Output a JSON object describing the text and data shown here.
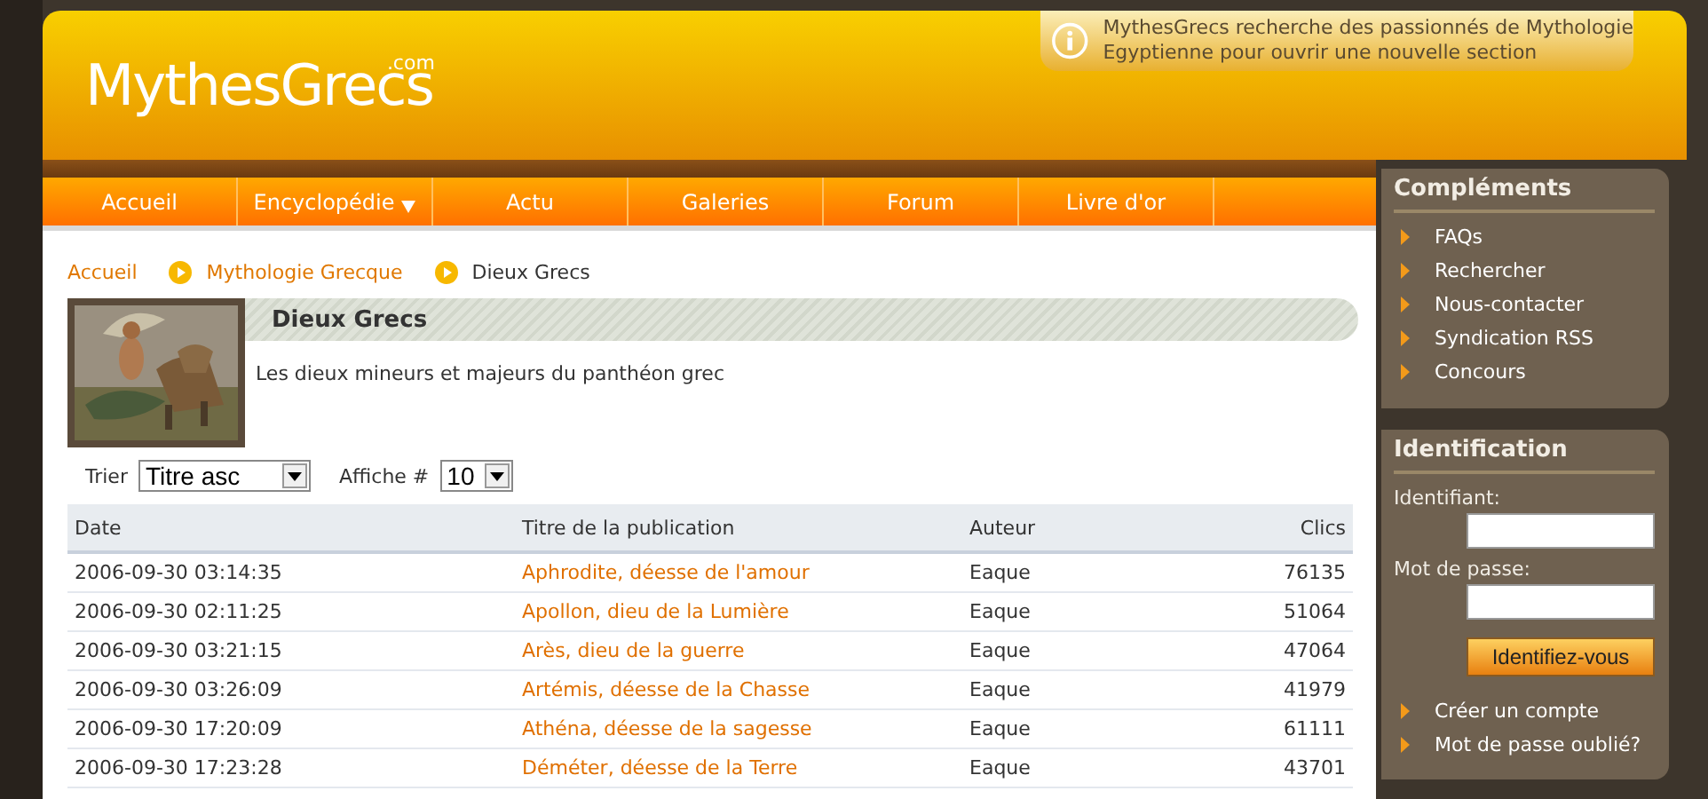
{
  "logo": {
    "name": "MythesGrecs",
    "suffix": ".com"
  },
  "notice": {
    "lines": [
      "MythesGrecs recherche des passionnés de Mythologie",
      "Egyptienne pour ouvrir une nouvelle section"
    ]
  },
  "nav": [
    {
      "label": "Accueil",
      "dropdown": false
    },
    {
      "label": "Encyclopédie",
      "dropdown": true
    },
    {
      "label": "Actu",
      "dropdown": false
    },
    {
      "label": "Galeries",
      "dropdown": false
    },
    {
      "label": "Forum",
      "dropdown": false
    },
    {
      "label": "Livre d'or",
      "dropdown": false
    }
  ],
  "breadcrumb": [
    {
      "label": "Accueil",
      "link": true
    },
    {
      "label": "Mythologie Grecque",
      "link": true
    },
    {
      "label": "Dieux Grecs",
      "link": false
    }
  ],
  "page": {
    "title": "Dieux Grecs",
    "description": "Les dieux mineurs et majeurs du panthéon grec"
  },
  "sort": {
    "label": "Trier",
    "value": "Titre asc"
  },
  "per_page": {
    "label": "Affiche #",
    "value": "10"
  },
  "table": {
    "columns": [
      "Date",
      "Titre de la publication",
      "Auteur",
      "Clics"
    ],
    "rows": [
      [
        "2006-09-30 03:14:35",
        "Aphrodite, déesse de l'amour",
        "Eaque",
        "76135"
      ],
      [
        "2006-09-30 02:11:25",
        "Apollon, dieu de la Lumière",
        "Eaque",
        "51064"
      ],
      [
        "2006-09-30 03:21:15",
        "Arès, dieu de la guerre",
        "Eaque",
        "47064"
      ],
      [
        "2006-09-30 03:26:09",
        "Artémis, déesse de la Chasse",
        "Eaque",
        "41979"
      ],
      [
        "2006-09-30 17:20:09",
        "Athéna, déesse de la sagesse",
        "Eaque",
        "61111"
      ],
      [
        "2006-09-30 17:23:28",
        "Déméter, déesse de la Terre",
        "Eaque",
        "43701"
      ]
    ]
  },
  "sidebar": {
    "complements": {
      "title": "Compléments",
      "items": [
        "FAQs",
        "Rechercher",
        "Nous-contacter",
        "Syndication RSS",
        "Concours"
      ]
    },
    "login": {
      "title": "Identification",
      "username_label": "Identifiant:",
      "password_label": "Mot de passe:",
      "button": "Identifiez-vous",
      "links": [
        "Créer un compte",
        "Mot de passe oublié?"
      ]
    }
  }
}
